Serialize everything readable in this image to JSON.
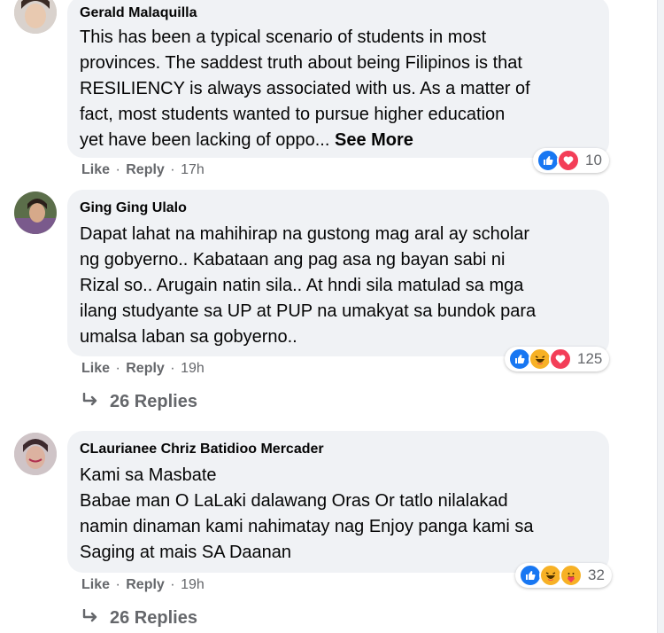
{
  "comments": [
    {
      "author": "Gerald Malaquilla",
      "lines": [
        "This has been a typical scenario of students in most",
        "provinces. The saddest truth about being Filipinos is that",
        "RESILIENCY is always associated with us. As a matter of",
        "fact, most students wanted to pursue higher education",
        "yet have been lacking of oppo..."
      ],
      "see_more": "See More",
      "like_label": "Like",
      "reply_label": "Reply",
      "time": "17h",
      "reaction_icons": [
        "like-icon",
        "love-icon"
      ],
      "reaction_count": "10"
    },
    {
      "author": "Ging Ging Ulalo",
      "lines": [
        "Dapat lahat na mahihirap na gustong mag aral ay scholar",
        "ng gobyerno.. Kabataan ang pag asa ng bayan sabi ni",
        "Rizal so.. Arugain natin sila.. At hndi sila matulad sa mga",
        "ilang studyante sa UP at PUP na umakyat sa bundok para",
        "umalsa laban sa gobyerno.."
      ],
      "like_label": "Like",
      "reply_label": "Reply",
      "time": "19h",
      "reaction_icons": [
        "like-icon",
        "haha-icon",
        "love-icon"
      ],
      "reaction_count": "125",
      "replies": "26 Replies"
    },
    {
      "author": "CLaurianee Chriz Batidioo Mercader",
      "lines": [
        "Kami sa Masbate",
        "Babae man O LaLaki dalawang Oras Or tatlo nilalakad",
        "namin dinaman kami nahimatay nag Enjoy panga kami sa",
        "Saging at mais SA Daanan"
      ],
      "like_label": "Like",
      "reply_label": "Reply",
      "time": "19h",
      "reaction_icons": [
        "like-icon",
        "haha-icon",
        "care-icon"
      ],
      "reaction_count": "32",
      "replies": "26 Replies"
    }
  ],
  "separator": "·",
  "colors": {
    "like": "#1877f2",
    "love": "#f33e58",
    "haha": "#f7b125",
    "bubble": "#f0f2f5",
    "meta": "#65676b"
  }
}
